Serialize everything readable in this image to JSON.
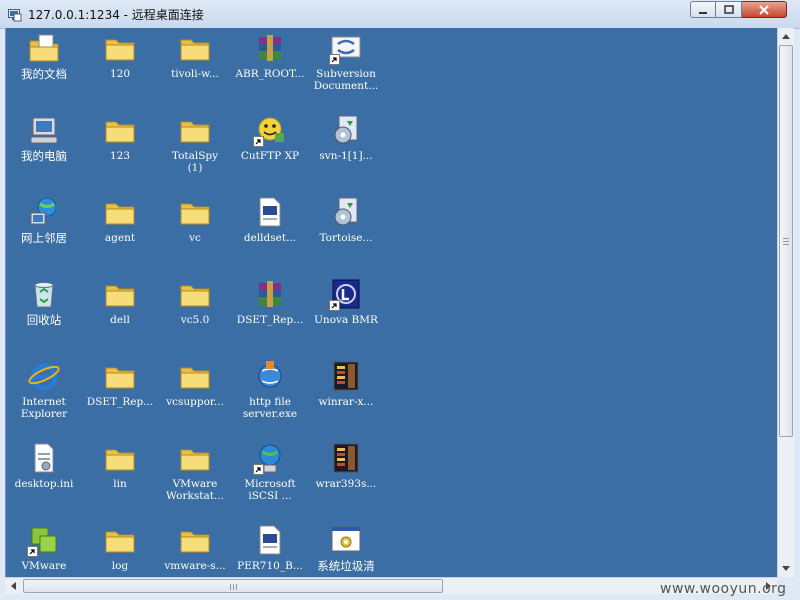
{
  "window": {
    "title": "127.0.0.1:1234 - 远程桌面连接"
  },
  "desktop": {
    "background_color": "#3a6ea5",
    "icons": [
      {
        "label": "我的文档",
        "icon": "my-documents-icon",
        "cjk": true
      },
      {
        "label": "120",
        "icon": "folder-icon"
      },
      {
        "label": "tivoli-w...",
        "icon": "folder-icon"
      },
      {
        "label": "ABR_ROOT...",
        "icon": "winrar-archive-icon"
      },
      {
        "label": "Subversion\nDocument...",
        "icon": "subversion-shortcut-icon",
        "shortcut": true
      },
      {
        "label": "我的电脑",
        "icon": "my-computer-icon",
        "cjk": true
      },
      {
        "label": "123",
        "icon": "folder-icon"
      },
      {
        "label": "TotalSpy\n(1)",
        "icon": "folder-icon"
      },
      {
        "label": "CutFTP XP",
        "icon": "cutftp-shortcut-icon",
        "shortcut": true
      },
      {
        "label": "svn-1[1]...",
        "icon": "installer-icon"
      },
      {
        "label": "网上邻居",
        "icon": "network-places-icon",
        "cjk": true
      },
      {
        "label": "agent",
        "icon": "folder-icon"
      },
      {
        "label": "vc",
        "icon": "folder-icon"
      },
      {
        "label": "delldset...",
        "icon": "document-icon"
      },
      {
        "label": "Tortoise...",
        "icon": "installer-icon"
      },
      {
        "label": "回收站",
        "icon": "recycle-bin-icon",
        "cjk": true
      },
      {
        "label": "dell",
        "icon": "folder-icon"
      },
      {
        "label": "vc5.0",
        "icon": "folder-icon"
      },
      {
        "label": "DSET_Rep...",
        "icon": "winrar-archive-icon"
      },
      {
        "label": "Unova BMR",
        "icon": "unova-shortcut-icon",
        "shortcut": true
      },
      {
        "label": "Internet\nExplorer",
        "icon": "internet-explorer-icon"
      },
      {
        "label": "DSET_Rep...",
        "icon": "folder-icon"
      },
      {
        "label": "vcsuppor...",
        "icon": "folder-icon"
      },
      {
        "label": "http file\nserver.exe",
        "icon": "http-file-server-icon"
      },
      {
        "label": "winrar-x...",
        "icon": "winrar-installer-icon"
      },
      {
        "label": "desktop.ini",
        "icon": "ini-file-icon"
      },
      {
        "label": "lin",
        "icon": "folder-icon"
      },
      {
        "label": "VMware\nWorkstat...",
        "icon": "folder-icon"
      },
      {
        "label": "Microsoft\niSCSI ...",
        "icon": "iscsi-shortcut-icon",
        "shortcut": true
      },
      {
        "label": "wrar393s...",
        "icon": "winrar-installer-icon"
      },
      {
        "label": "VMware",
        "icon": "vmware-shortcut-icon",
        "shortcut": true
      },
      {
        "label": "log",
        "icon": "folder-icon"
      },
      {
        "label": "vmware-s...",
        "icon": "folder-icon"
      },
      {
        "label": "PER710_B...",
        "icon": "document-icon"
      },
      {
        "label": "系统垃圾清",
        "icon": "batch-file-icon",
        "cjk": true
      }
    ]
  },
  "watermark": "www.wooyun.org"
}
